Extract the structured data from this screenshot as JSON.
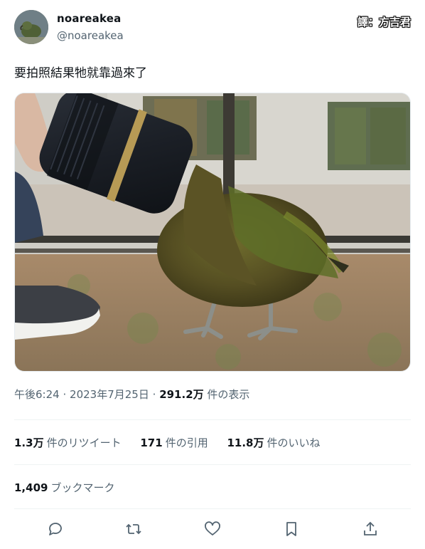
{
  "author": {
    "display_name": "noareakea",
    "handle": "@noareakea"
  },
  "watermark": "譯：方吉君",
  "tweet": {
    "text": "要拍照結果牠就靠過來了"
  },
  "meta": {
    "time": "午後6:24",
    "separator": "·",
    "date": "2023年7月25日",
    "views_count": "291.2万",
    "views_label": "件の表示"
  },
  "stats": {
    "retweets_count": "1.3万",
    "retweets_label": "件のリツイート",
    "quotes_count": "171",
    "quotes_label": "件の引用",
    "likes_count": "11.8万",
    "likes_label": "件のいいね",
    "bookmarks_count": "1,409",
    "bookmarks_label": "ブックマーク"
  },
  "icons": {
    "reply": "reply-icon",
    "retweet": "retweet-icon",
    "like": "heart-icon",
    "bookmark": "bookmark-icon",
    "share": "share-icon"
  },
  "colors": {
    "text_primary": "#0f1419",
    "text_secondary": "#536471",
    "divider": "#eff3f4"
  }
}
